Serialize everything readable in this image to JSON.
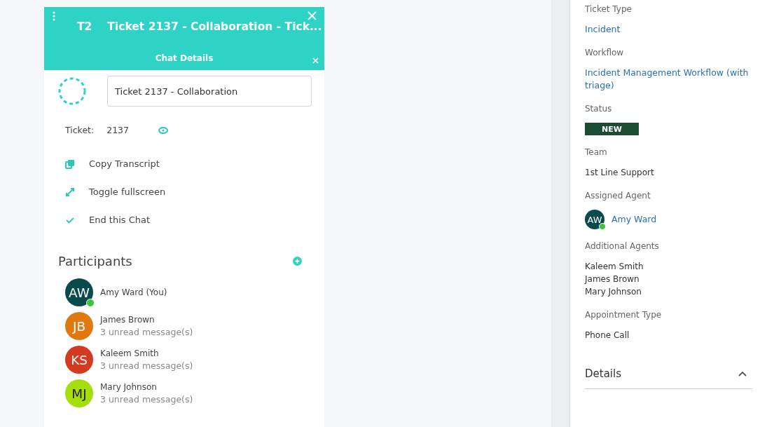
{
  "chat": {
    "tag": "T2",
    "title": "Ticket 2137 - Collaboration - Tick...",
    "subheader": "Chat Details",
    "name_value": "Ticket 2137 - Collaboration",
    "ticket_label": "Ticket:",
    "ticket_number": "2137",
    "actions": [
      {
        "kind": "copy",
        "label": "Copy Transcript"
      },
      {
        "kind": "fullscreen",
        "label": "Toggle fullscreen"
      },
      {
        "kind": "end",
        "label": "End this Chat"
      }
    ],
    "participants_title": "Participants",
    "participants": [
      {
        "initials": "AW",
        "name": "Amy Ward (You)",
        "color": "#0b4a4a",
        "online": true
      },
      {
        "initials": "JB",
        "name": "James Brown",
        "note": "3 unread message(s)",
        "color": "#e07a10",
        "online": false
      },
      {
        "initials": "KS",
        "name": "Kaleem Smith",
        "note": "3 unread message(s)",
        "color": "#d33a1f",
        "online": false
      },
      {
        "initials": "MJ",
        "name": "Mary Johnson",
        "note": "3 unread message(s)",
        "color": "#a6dd0c",
        "online": false
      }
    ]
  },
  "details": {
    "fields": [
      {
        "kind": "link",
        "label": "Ticket Type",
        "value": "Incident"
      },
      {
        "kind": "link",
        "label": "Workflow",
        "value": "Incident Management Workflow (with triage)"
      },
      {
        "kind": "badge",
        "label": "Status",
        "value": "NEW"
      },
      {
        "kind": "text",
        "label": "Team",
        "value": "1st Line Support"
      },
      {
        "kind": "agent",
        "label": "Assigned Agent",
        "initials": "AW",
        "value": "Amy Ward",
        "online": true
      },
      {
        "kind": "list",
        "label": "Additional Agents",
        "values": [
          "Kaleem Smith",
          "James Brown",
          "Mary Johnson"
        ]
      },
      {
        "kind": "text",
        "label": "Appointment Type",
        "value": "Phone Call"
      }
    ],
    "section": {
      "title": "Details",
      "expanded": true
    }
  }
}
